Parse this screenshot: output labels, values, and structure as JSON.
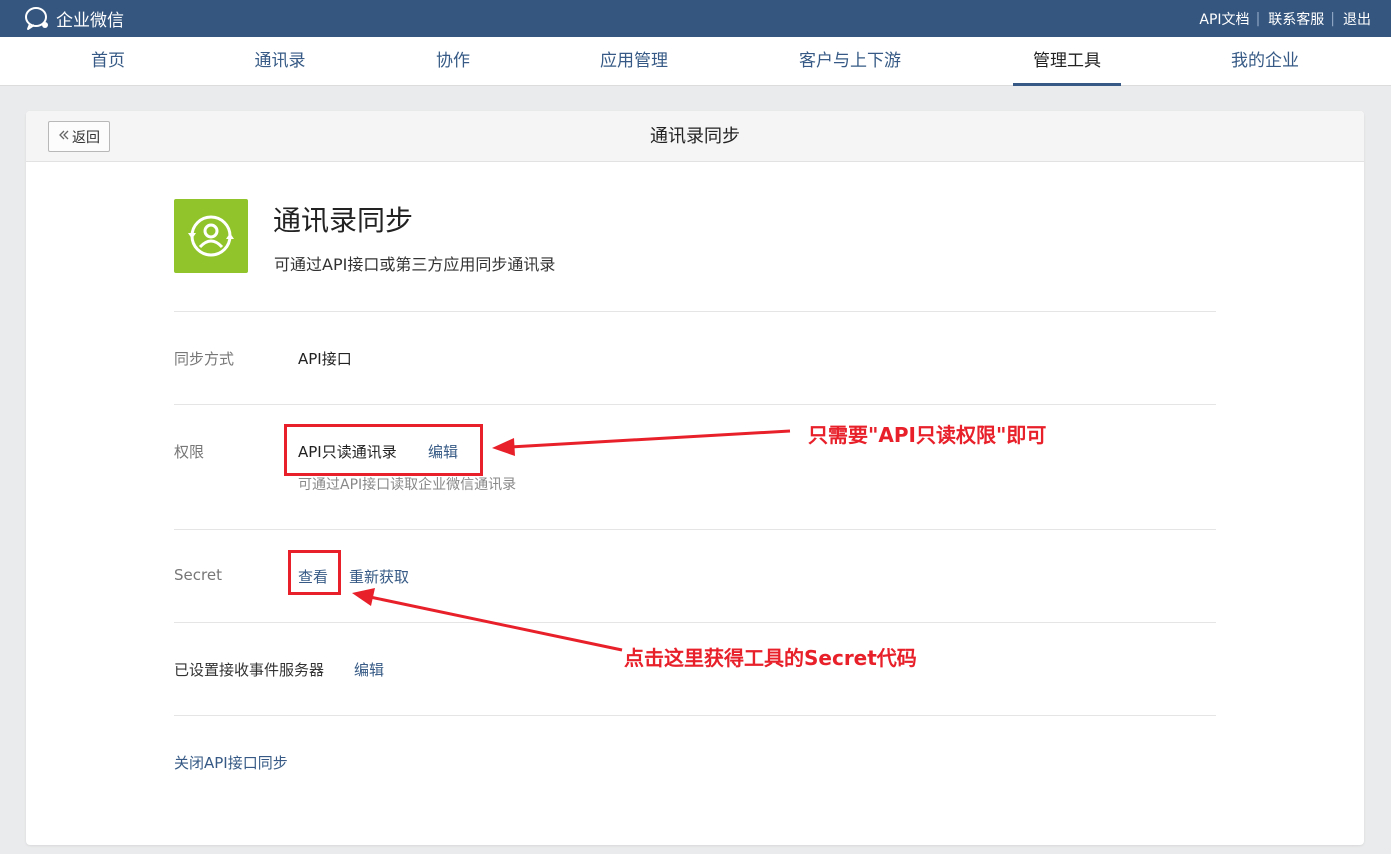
{
  "header": {
    "brand": "企业微信",
    "links": [
      "API文档",
      "联系客服",
      "退出"
    ]
  },
  "nav": {
    "items": [
      "首页",
      "通讯录",
      "协作",
      "应用管理",
      "客户与上下游",
      "管理工具",
      "我的企业"
    ],
    "active": "管理工具"
  },
  "panel": {
    "back_label": "返回",
    "title": "通讯录同步"
  },
  "app": {
    "name": "通讯录同步",
    "description": "可通过API接口或第三方应用同步通讯录",
    "icon": "contact-sync-icon",
    "icon_color": "#90c42a"
  },
  "rows": {
    "sync_mode": {
      "label": "同步方式",
      "value": "API接口"
    },
    "permission": {
      "label": "权限",
      "value": "API只读通讯录",
      "edit": "编辑",
      "hint": "可通过API接口读取企业微信通讯录"
    },
    "secret": {
      "label": "Secret",
      "view": "查看",
      "refresh": "重新获取"
    },
    "event_server": {
      "label": "已设置接收事件服务器",
      "edit": "编辑"
    },
    "close_link": "关闭API接口同步"
  },
  "annotations": {
    "permission_note": "只需要\"API只读权限\"即可",
    "secret_note": "点击这里获得工具的Secret代码",
    "color": "#e8202a"
  },
  "colors": {
    "topbar": "#35567f",
    "link": "#365a85",
    "background": "#eaebec"
  }
}
